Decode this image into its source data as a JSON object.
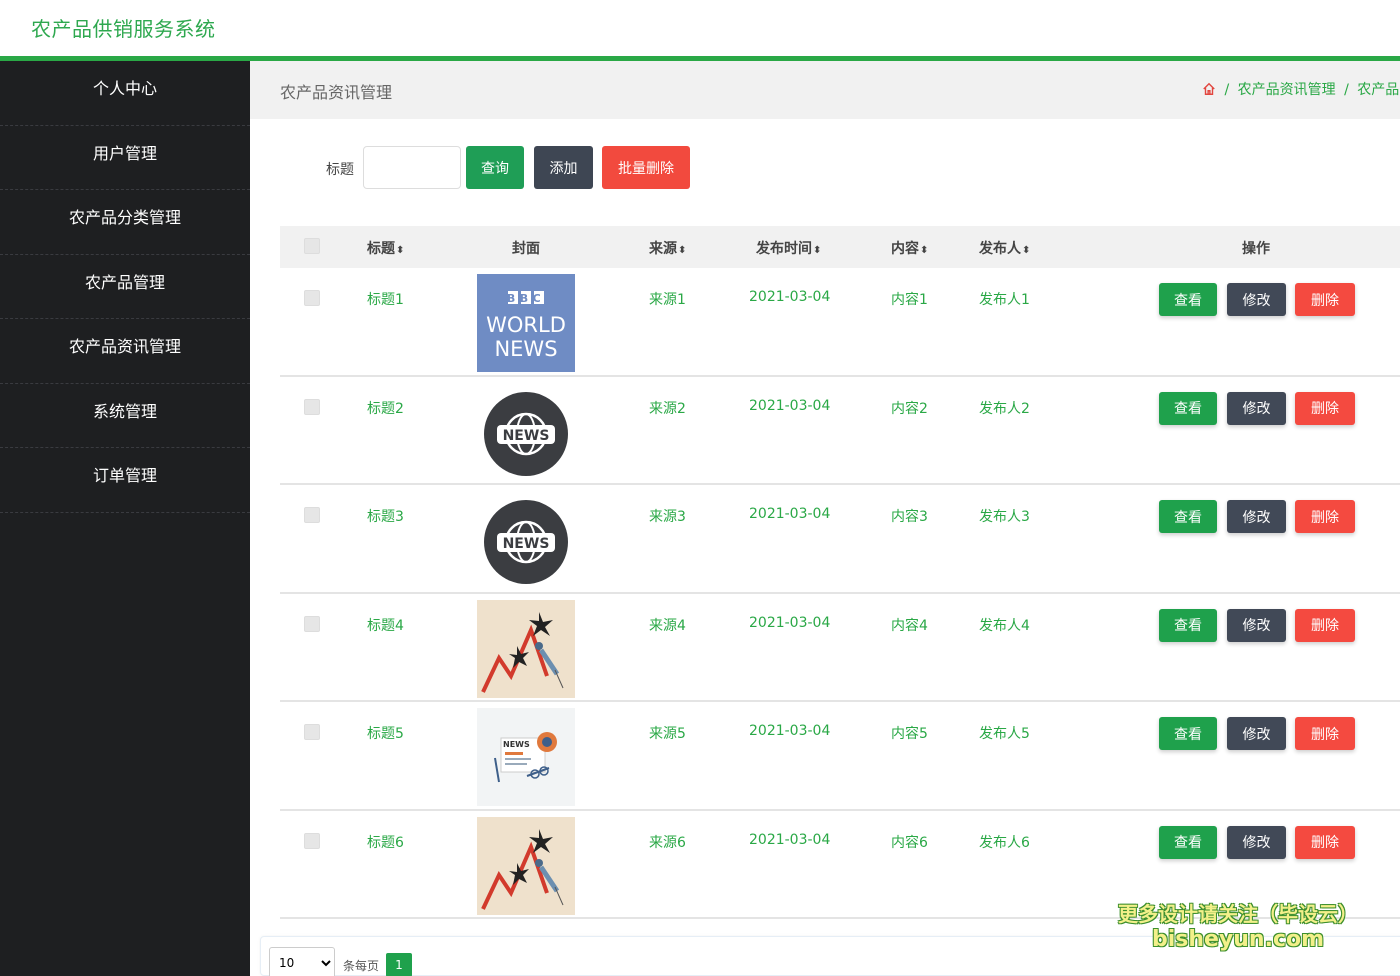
{
  "app": {
    "title": "农产品供销服务系统"
  },
  "sidebar": {
    "items": [
      {
        "label": "个人中心"
      },
      {
        "label": "用户管理"
      },
      {
        "label": "农产品分类管理"
      },
      {
        "label": "农产品管理"
      },
      {
        "label": "农产品资讯管理"
      },
      {
        "label": "系统管理"
      },
      {
        "label": "订单管理"
      }
    ]
  },
  "page": {
    "title": "农产品资讯管理",
    "breadcrumb": [
      "农产品资讯管理",
      "农产品资讯"
    ],
    "breadcrumb_sep": "/"
  },
  "search": {
    "label": "标题",
    "value": "",
    "placeholder": "",
    "query_label": "查询",
    "add_label": "添加",
    "batch_delete_label": "批量删除"
  },
  "table": {
    "headers": {
      "title": "标题",
      "cover": "封面",
      "source": "来源",
      "publish_time": "发布时间",
      "content": "内容",
      "publisher": "发布人",
      "actions": "操作"
    },
    "rows": [
      {
        "title": "标题1",
        "cover": "bbc-world-news-image",
        "source": "来源1",
        "publish_time": "2021-03-04",
        "content": "内容1",
        "publisher": "发布人1"
      },
      {
        "title": "标题2",
        "cover": "news-globe-badge-image",
        "source": "来源2",
        "publish_time": "2021-03-04",
        "content": "内容2",
        "publisher": "发布人2"
      },
      {
        "title": "标题3",
        "cover": "news-globe-badge-image",
        "source": "来源3",
        "publish_time": "2021-03-04",
        "content": "内容3",
        "publisher": "发布人3"
      },
      {
        "title": "标题4",
        "cover": "falling-chart-illustration",
        "source": "来源4",
        "publish_time": "2021-03-04",
        "content": "内容4",
        "publisher": "发布人4"
      },
      {
        "title": "标题5",
        "cover": "newspaper-illustration",
        "source": "来源5",
        "publish_time": "2021-03-04",
        "content": "内容5",
        "publisher": "发布人5"
      },
      {
        "title": "标题6",
        "cover": "falling-chart-illustration",
        "source": "来源6",
        "publish_time": "2021-03-04",
        "content": "内容6",
        "publisher": "发布人6"
      }
    ],
    "row_actions": {
      "view": "查看",
      "edit": "修改",
      "delete": "删除"
    }
  },
  "pagination": {
    "page_size": "10",
    "page_size_label": "条每页",
    "current_page": "1"
  },
  "cover_text": {
    "bbc": "BBC",
    "world": "WORLD",
    "news": "NEWS",
    "badge": "NEWS",
    "paper": "NEWS"
  },
  "watermark": {
    "line1": "更多设计请关注（毕设云）",
    "line2": "bisheyun.com"
  },
  "colors": {
    "brand_green": "#2aa846",
    "sidebar_bg": "#1e1f21",
    "danger": "#f44a40",
    "dark_button": "#414957"
  }
}
